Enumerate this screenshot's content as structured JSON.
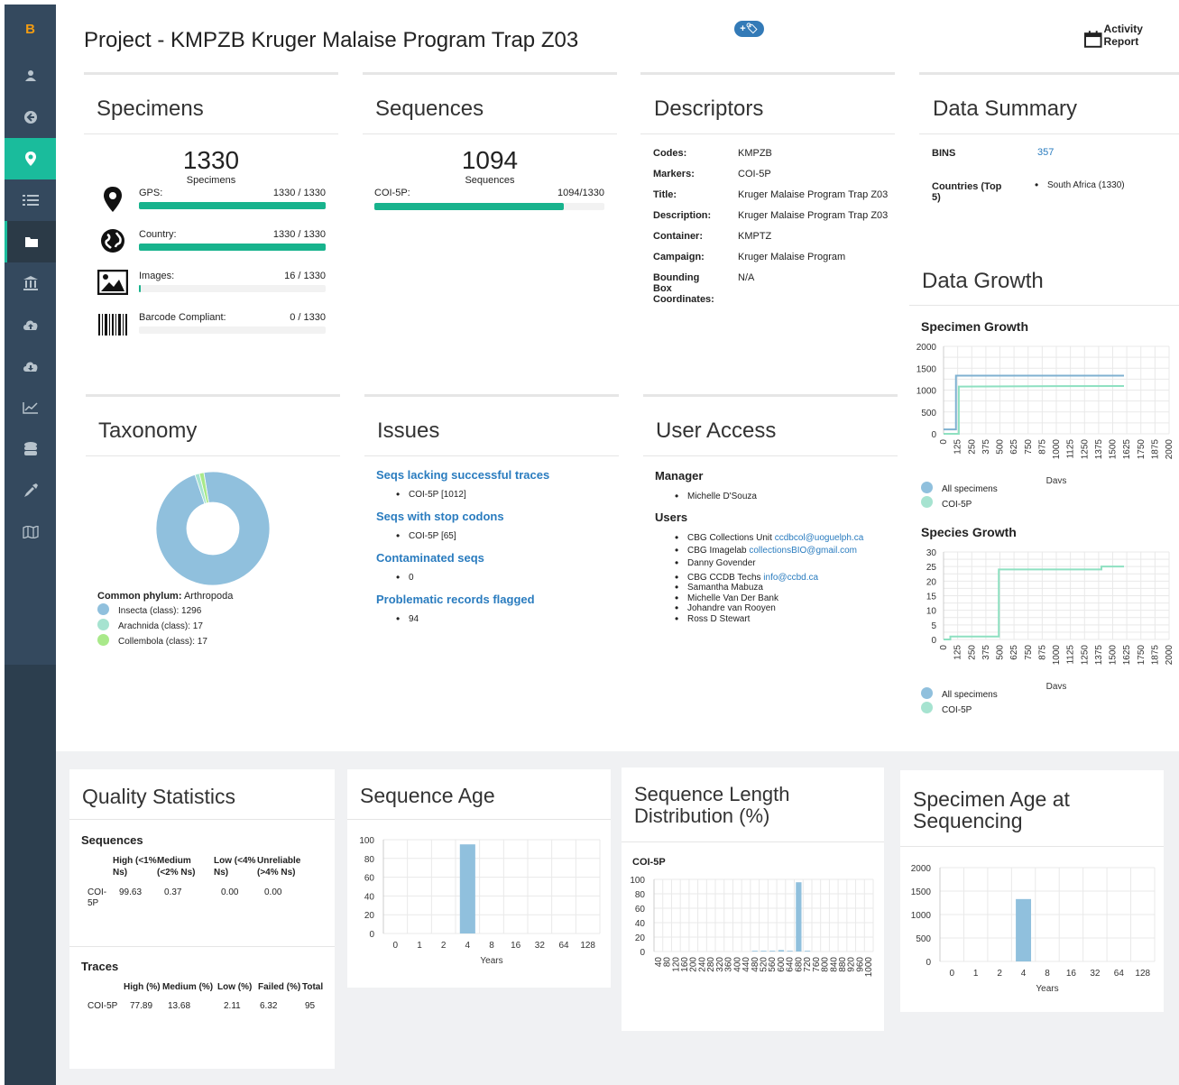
{
  "sidebar": {
    "logo": "B",
    "items": [
      "user-icon",
      "back-circle-icon",
      "map-pin-icon",
      "list-icon",
      "folder-icon",
      "bank-icon",
      "cloud-upload-icon",
      "cloud-download-icon",
      "line-chart-icon",
      "database-icon",
      "eyedropper-icon",
      "map-icon"
    ],
    "active_color": "#1abc9c"
  },
  "header": {
    "title": "Project - KMPZB Kruger Malaise Program Trap Z03",
    "badge": "+🏷",
    "activity_report": "Activity Report"
  },
  "specimens": {
    "title": "Specimens",
    "count": "1330",
    "count_label": "Specimens",
    "rows": [
      {
        "label": "GPS:",
        "value": "1330 / 1330",
        "fraction": 1.0,
        "icon": "map-marker-icon"
      },
      {
        "label": "Country:",
        "value": "1330 / 1330",
        "fraction": 1.0,
        "icon": "globe-icon"
      },
      {
        "label": "Images:",
        "value": "16 / 1330",
        "fraction": 0.012,
        "icon": "image-icon"
      },
      {
        "label": "Barcode Compliant:",
        "value": "0 / 1330",
        "fraction": 0.0,
        "icon": "barcode-icon"
      }
    ]
  },
  "sequences": {
    "title": "Sequences",
    "count": "1094",
    "count_label": "Sequences",
    "rows": [
      {
        "label": "COI-5P:",
        "value": "1094/1330",
        "fraction": 0.823
      }
    ]
  },
  "descriptors": {
    "title": "Descriptors",
    "rows": [
      {
        "k": "Codes:",
        "v": "KMPZB"
      },
      {
        "k": "Markers:",
        "v": "COI-5P"
      },
      {
        "k": "Title:",
        "v": "Kruger Malaise Program Trap Z03"
      },
      {
        "k": "Description:",
        "v": "Kruger Malaise Program Trap Z03"
      },
      {
        "k": "Container:",
        "v": "KMPTZ"
      },
      {
        "k": "Campaign:",
        "v": "Kruger Malaise Program"
      },
      {
        "k": "Bounding Box Coordinates:",
        "v": "N/A"
      }
    ]
  },
  "data_summary": {
    "title": "Data Summary",
    "bins_label": "BINS",
    "bins_value": "357",
    "countries_label": "Countries (Top 5)",
    "countries": [
      "South Africa (1330)"
    ]
  },
  "data_growth": {
    "title": "Data Growth",
    "specimen_growth": "Specimen Growth",
    "species_growth": "Species Growth",
    "xlabel": "Days",
    "legend": [
      "All specimens",
      "COI-5P"
    ]
  },
  "taxonomy": {
    "title": "Taxonomy",
    "common_label": "Common phylum:",
    "common_value": "Arthropoda",
    "classes": [
      {
        "label": "Insecta (class): 1296",
        "value": 1296,
        "color": "#90c0dd"
      },
      {
        "label": "Arachnida (class): 17",
        "value": 17,
        "color": "#a6e3d0"
      },
      {
        "label": "Collembola (class): 17",
        "value": 17,
        "color": "#a9e98a"
      }
    ]
  },
  "issues": {
    "title": "Issues",
    "groups": [
      {
        "h": "Seqs lacking successful traces",
        "items": [
          "COI-5P [1012]"
        ]
      },
      {
        "h": "Seqs with stop codons",
        "items": [
          "COI-5P [65]"
        ]
      },
      {
        "h": "Contaminated seqs",
        "items": [
          "0"
        ]
      },
      {
        "h": "Problematic records flagged",
        "items": [
          "94"
        ]
      }
    ]
  },
  "user_access": {
    "title": "User Access",
    "manager_h": "Manager",
    "manager": "Michelle D'Souza",
    "users_h": "Users",
    "users": [
      {
        "name": "CBG Collections Unit ",
        "email": "ccdbcol@uoguelph.ca"
      },
      {
        "name": "CBG Imagelab ",
        "email": "collectionsBIO@gmail.com"
      },
      {
        "name": "Danny Govender",
        "email": ""
      },
      {
        "name": "CBG CCDB Techs ",
        "email": "info@ccbd.ca"
      },
      {
        "name": "Samantha Mabuza",
        "email": ""
      },
      {
        "name": "Michelle Van Der Bank",
        "email": ""
      },
      {
        "name": "Johandre van Rooyen",
        "email": ""
      },
      {
        "name": "Ross D Stewart",
        "email": ""
      }
    ]
  },
  "quality": {
    "title": "Quality Statistics",
    "seq_h": "Sequences",
    "seq_cols": [
      "High (<1% Ns)",
      "Medium (<2% Ns)",
      "Low (<4% Ns)",
      "Unreliable (>4% Ns)"
    ],
    "seq_row": {
      "marker": "COI-5P",
      "vals": [
        "99.63",
        "0.37",
        "0.00",
        "0.00"
      ]
    },
    "traces_h": "Traces",
    "trace_cols": [
      "High (%)",
      "Medium (%)",
      "Low (%)",
      "Failed (%)",
      "Total"
    ],
    "trace_row": {
      "marker": "COI-5P",
      "vals": [
        "77.89",
        "13.68",
        "2.11",
        "6.32",
        "95"
      ]
    }
  },
  "seq_age": {
    "title": "Sequence Age",
    "xlabel": "Years"
  },
  "seq_len": {
    "title": "Sequence Length Distribution (%)",
    "marker": "COI-5P"
  },
  "spec_age": {
    "title": "Specimen Age at Sequencing",
    "xlabel": "Years"
  },
  "chart_data": [
    {
      "type": "line",
      "title": "Specimen Growth",
      "xlabel": "Days",
      "ylim": [
        0,
        2000
      ],
      "yticks": [
        0,
        500,
        1000,
        1500,
        2000
      ],
      "x_ticks": [
        0,
        125,
        250,
        375,
        500,
        625,
        750,
        875,
        1000,
        1125,
        1250,
        1375,
        1500,
        1625,
        1750,
        1875,
        2000
      ],
      "series": [
        {
          "name": "All specimens",
          "color": "#7fb1d1",
          "points": [
            [
              0,
              100
            ],
            [
              110,
              100
            ],
            [
              110,
              1330
            ],
            [
              1600,
              1330
            ]
          ]
        },
        {
          "name": "COI-5P",
          "color": "#8ee0c1",
          "points": [
            [
              0,
              0
            ],
            [
              135,
              0
            ],
            [
              135,
              1080
            ],
            [
              1000,
              1090
            ],
            [
              1600,
              1094
            ]
          ]
        }
      ]
    },
    {
      "type": "line",
      "title": "Species Growth",
      "xlabel": "Days",
      "ylim": [
        0,
        30
      ],
      "yticks": [
        0,
        5,
        10,
        15,
        20,
        25,
        30
      ],
      "x_ticks": [
        0,
        125,
        250,
        375,
        500,
        625,
        750,
        875,
        1000,
        1125,
        1250,
        1375,
        1500,
        1625,
        1750,
        1875,
        2000
      ],
      "series": [
        {
          "name": "COI-5P",
          "color": "#8ee0c1",
          "points": [
            [
              0,
              0
            ],
            [
              60,
              0
            ],
            [
              60,
              1
            ],
            [
              490,
              1
            ],
            [
              490,
              24
            ],
            [
              1400,
              24
            ],
            [
              1400,
              25
            ],
            [
              1600,
              25
            ]
          ]
        }
      ]
    },
    {
      "type": "bar",
      "title": "Sequence Age",
      "categories": [
        "0",
        "1",
        "2",
        "4",
        "8",
        "16",
        "32",
        "64",
        "128"
      ],
      "values": [
        0,
        0,
        0,
        95,
        0,
        0,
        0,
        0,
        0
      ],
      "ylim": [
        0,
        100
      ],
      "yticks": [
        0,
        20,
        40,
        60,
        80,
        100
      ],
      "xlabel": "Years",
      "color": "#90c0dd"
    },
    {
      "type": "bar",
      "title": "Sequence Length Distribution (%)",
      "categories": [
        "40",
        "80",
        "120",
        "160",
        "200",
        "240",
        "280",
        "320",
        "360",
        "400",
        "440",
        "480",
        "520",
        "560",
        "600",
        "640",
        "680",
        "720",
        "760",
        "800",
        "840",
        "880",
        "920",
        "960",
        "1000"
      ],
      "values": [
        0,
        0,
        0,
        0,
        0,
        0,
        0,
        0,
        0,
        0,
        0,
        1,
        1,
        1,
        2,
        1,
        96,
        1,
        0,
        0,
        0,
        0,
        0,
        0,
        0
      ],
      "ylim": [
        0,
        100
      ],
      "yticks": [
        0,
        20,
        40,
        60,
        80,
        100
      ],
      "color": "#90c0dd"
    },
    {
      "type": "bar",
      "title": "Specimen Age at Sequencing",
      "categories": [
        "0",
        "1",
        "2",
        "4",
        "8",
        "16",
        "32",
        "64",
        "128"
      ],
      "values": [
        0,
        0,
        0,
        1330,
        0,
        0,
        0,
        0,
        0
      ],
      "ylim": [
        0,
        2000
      ],
      "yticks": [
        0,
        500,
        1000,
        1500,
        2000
      ],
      "xlabel": "Years",
      "color": "#90c0dd"
    }
  ]
}
